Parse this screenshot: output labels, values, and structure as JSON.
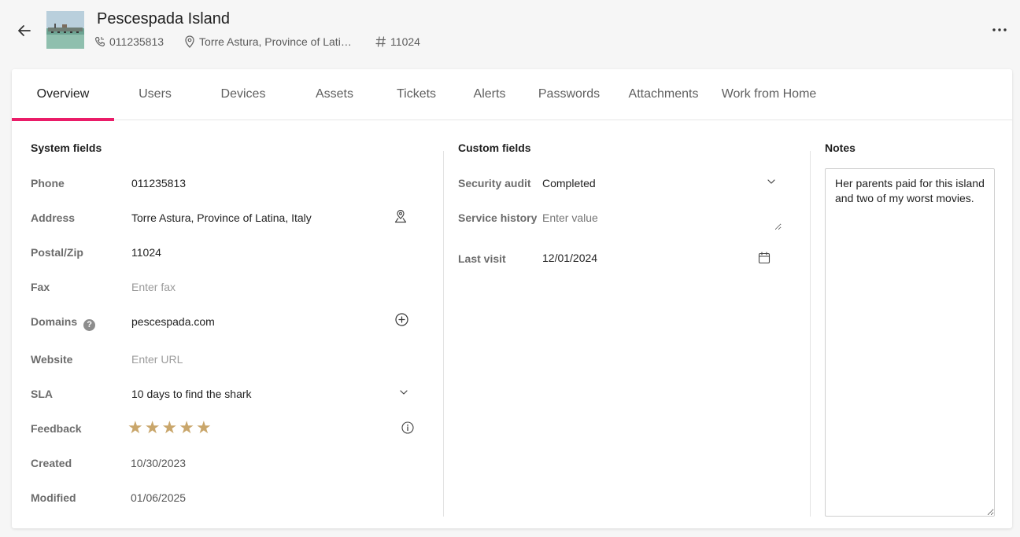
{
  "header": {
    "title": "Pescespada Island",
    "phone": "011235813",
    "address": "Torre Astura, Province of Latina, Italy",
    "zip": "11024"
  },
  "tabs": [
    "Overview",
    "Users",
    "Devices",
    "Assets",
    "Tickets",
    "Alerts",
    "Passwords",
    "Attachments",
    "Work from Home"
  ],
  "system": {
    "title": "System fields",
    "phone_label": "Phone",
    "phone": "011235813",
    "address_label": "Address",
    "address": "Torre Astura, Province of Latina, Italy",
    "zip_label": "Postal/Zip",
    "zip": "11024",
    "fax_label": "Fax",
    "fax_placeholder": "Enter fax",
    "domains_label": "Domains",
    "domains_help": "?",
    "domain": "pescespada.com",
    "website_label": "Website",
    "website_placeholder": "Enter URL",
    "sla_label": "SLA",
    "sla": "10 days to find the shark",
    "feedback_label": "Feedback",
    "feedback_rating": 5,
    "feedback_max": 5,
    "created_label": "Created",
    "created": "10/30/2023",
    "modified_label": "Modified",
    "modified": "01/06/2025"
  },
  "custom": {
    "title": "Custom fields",
    "security_label": "Security audit",
    "security": "Completed",
    "service_label": "Service history",
    "service_placeholder": "Enter value",
    "visit_label": "Last visit",
    "visit": "12/01/2024"
  },
  "notes": {
    "title": "Notes",
    "text": "Her parents paid for this island and two of my worst movies."
  },
  "colors": {
    "accent": "#ea1c68",
    "star": "#c9a66b"
  }
}
